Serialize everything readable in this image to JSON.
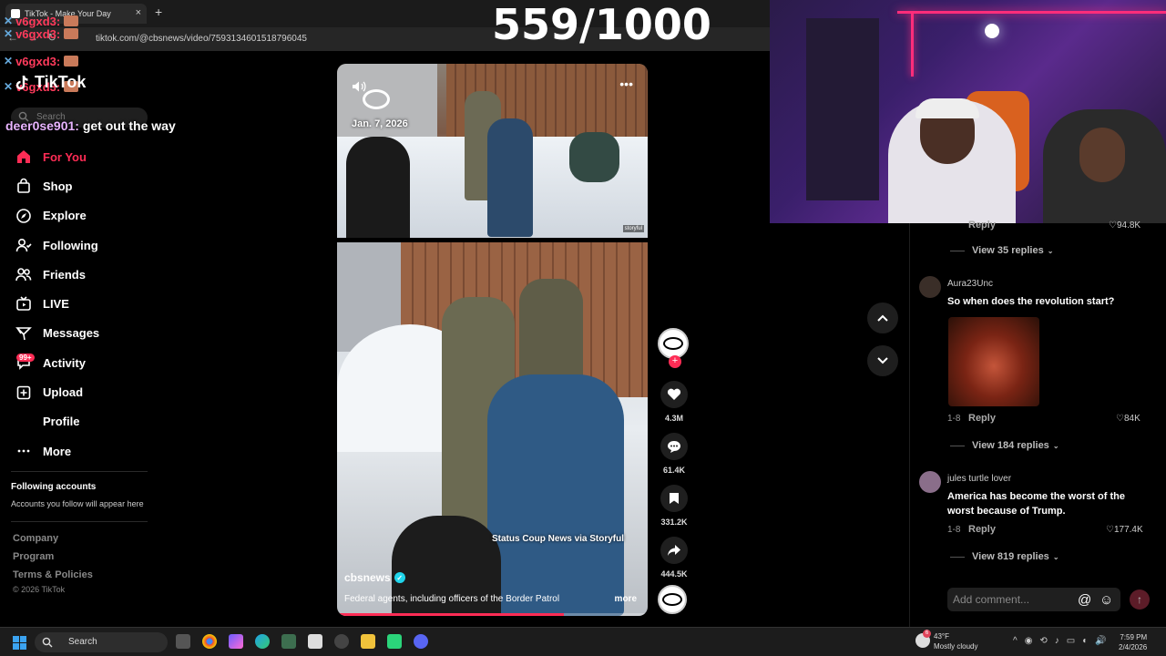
{
  "browser": {
    "tab_title": "TikTok - Make Your Day",
    "url": "tiktok.com/@cbsnews/video/7593134601518796045"
  },
  "overlay": {
    "counter": "559/1000",
    "chat_names": [
      "v6gxd3:",
      "v6gxd3:",
      "v6gxd3:",
      "v6gxd3:"
    ],
    "chat_message_user": "deer0se901:",
    "chat_message_text": "get out the way"
  },
  "sidebar": {
    "logo": "TikTok",
    "search_placeholder": "Search",
    "items": [
      {
        "label": "For You",
        "icon": "home-icon",
        "active": true
      },
      {
        "label": "Shop",
        "icon": "shop-icon"
      },
      {
        "label": "Explore",
        "icon": "compass-icon"
      },
      {
        "label": "Following",
        "icon": "following-icon"
      },
      {
        "label": "Friends",
        "icon": "friends-icon"
      },
      {
        "label": "LIVE",
        "icon": "live-icon"
      },
      {
        "label": "Messages",
        "icon": "messages-icon"
      },
      {
        "label": "Activity",
        "icon": "activity-icon",
        "badge": "99+"
      },
      {
        "label": "Upload",
        "icon": "upload-icon"
      },
      {
        "label": "Profile",
        "icon": "profile-icon"
      },
      {
        "label": "More",
        "icon": "more-icon"
      }
    ],
    "following_title": "Following accounts",
    "following_sub": "Accounts you follow will appear here",
    "footer_links": [
      "Company",
      "Program",
      "Terms & Policies"
    ],
    "copyright": "© 2026 TikTok"
  },
  "video": {
    "date": "Jan. 7, 2026",
    "storyful_tag": "storyful",
    "credit": "Status Coup News via Storyful",
    "author": "cbsnews",
    "caption": "Federal agents, including officers of the Border Patrol",
    "more": "more",
    "progress": 0.73
  },
  "actions": {
    "likes": "4.3M",
    "comments": "61.4K",
    "saves": "331.2K",
    "shares": "444.5K"
  },
  "comments": {
    "top_reply": "Reply",
    "top_likes": "94.8K",
    "top_view_replies": "View 35 replies",
    "items": [
      {
        "user": "Aura23Unc",
        "text": "So when does the revolution start?",
        "date": "1-8",
        "reply": "Reply",
        "likes": "84K",
        "view_replies": "View 184 replies"
      },
      {
        "user": "jules turtle lover",
        "text": "America has become the worst of the worst because of Trump.",
        "date": "1-8",
        "reply": "Reply",
        "likes": "177.4K",
        "view_replies": "View 819 replies"
      }
    ],
    "add_placeholder": "Add comment..."
  },
  "taskbar": {
    "search": "Search",
    "weather_temp": "43°F",
    "weather_desc": "Mostly cloudy",
    "weather_badge": "6",
    "time": "7:59 PM",
    "date": "2/4/2026"
  }
}
